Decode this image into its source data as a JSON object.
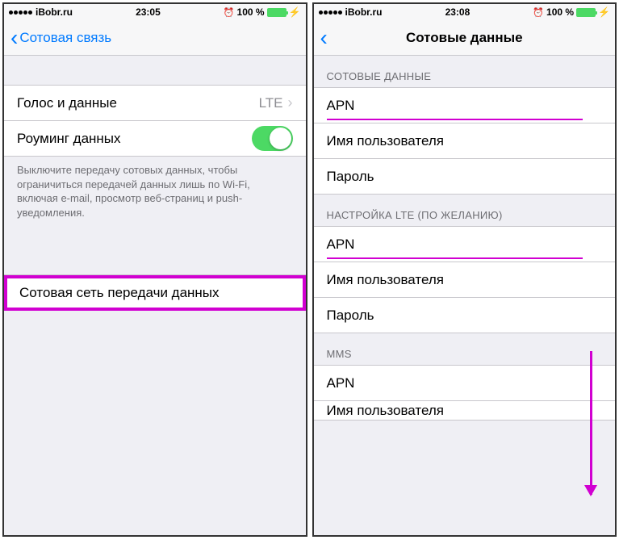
{
  "left": {
    "status": {
      "carrier": "iBobr.ru",
      "time": "23:05",
      "battery": "100 %"
    },
    "nav": {
      "back": "Сотовая связь"
    },
    "rows": {
      "voice_data": {
        "label": "Голос и данные",
        "value": "LTE"
      },
      "roaming": {
        "label": "Роуминг данных"
      }
    },
    "footer": "Выключите передачу сотовых данных, чтобы ограничиться передачей данных лишь по Wi-Fi, включая e-mail, просмотр веб-страниц и push-уведомления.",
    "network": {
      "label": "Сотовая сеть передачи данных"
    }
  },
  "right": {
    "status": {
      "carrier": "iBobr.ru",
      "time": "23:08",
      "battery": "100 %"
    },
    "nav": {
      "title": "Сотовые данные"
    },
    "sections": {
      "cellular": {
        "header": "СОТОВЫЕ ДАННЫЕ",
        "apn": "APN",
        "user": "Имя пользователя",
        "pass": "Пароль"
      },
      "lte": {
        "header": "НАСТРОЙКА LTE (ПО ЖЕЛАНИЮ)",
        "apn": "APN",
        "user": "Имя пользователя",
        "pass": "Пароль"
      },
      "mms": {
        "header": "MMS",
        "apn": "APN",
        "user": "Имя пользователя"
      }
    }
  }
}
